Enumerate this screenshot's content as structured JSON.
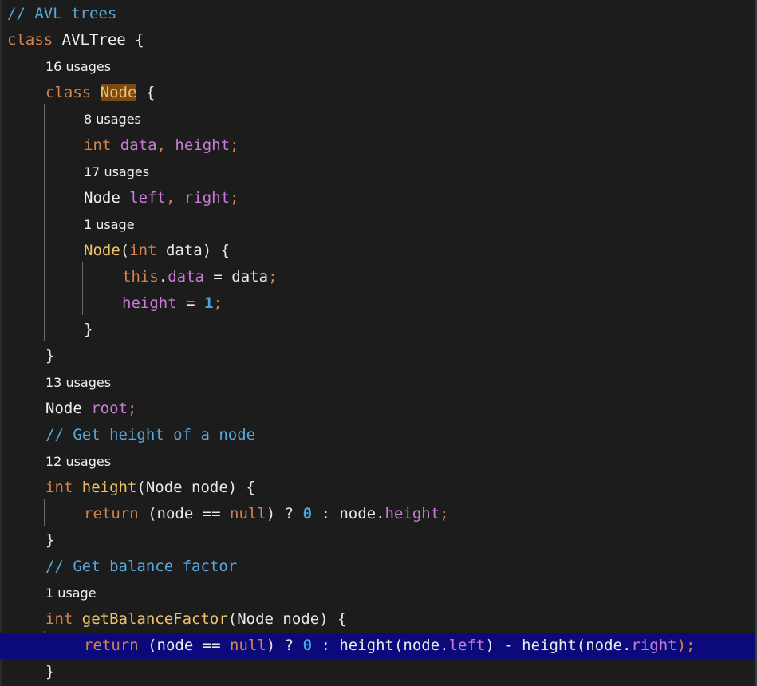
{
  "editor": {
    "language": "java",
    "accent_highlight": "#0c0a7a",
    "selection_color": "#7a4a12"
  },
  "lines": [
    {
      "indent": 0,
      "kind": "code",
      "tokens": [
        {
          "t": "// AVL trees",
          "c": "cmt"
        }
      ]
    },
    {
      "indent": 0,
      "kind": "code",
      "tokens": [
        {
          "t": "class ",
          "c": "kw"
        },
        {
          "t": "AVLTree",
          "c": "cls"
        },
        {
          "t": " {",
          "c": "punc"
        }
      ]
    },
    {
      "indent": 2,
      "kind": "hint",
      "text": "16 usages"
    },
    {
      "indent": 2,
      "kind": "code",
      "tokens": [
        {
          "t": "class ",
          "c": "kw"
        },
        {
          "t": "Node",
          "c": "hl-node"
        },
        {
          "t": " {",
          "c": "punc"
        }
      ]
    },
    {
      "indent": 4,
      "kind": "hint",
      "text": "8 usages"
    },
    {
      "indent": 4,
      "kind": "code",
      "tokens": [
        {
          "t": "int ",
          "c": "kw"
        },
        {
          "t": "data",
          "c": "field"
        },
        {
          "t": ", ",
          "c": "sc"
        },
        {
          "t": "height",
          "c": "field"
        },
        {
          "t": ";",
          "c": "sc"
        }
      ]
    },
    {
      "indent": 4,
      "kind": "hint",
      "text": "17 usages"
    },
    {
      "indent": 4,
      "kind": "code",
      "tokens": [
        {
          "t": "Node ",
          "c": "cls"
        },
        {
          "t": "left",
          "c": "field"
        },
        {
          "t": ", ",
          "c": "sc"
        },
        {
          "t": "right",
          "c": "field"
        },
        {
          "t": ";",
          "c": "sc"
        }
      ]
    },
    {
      "indent": 4,
      "kind": "hint",
      "text": "1 usage"
    },
    {
      "indent": 4,
      "kind": "code",
      "tokens": [
        {
          "t": "Node",
          "c": "fn"
        },
        {
          "t": "(",
          "c": "punc"
        },
        {
          "t": "int ",
          "c": "kw"
        },
        {
          "t": "data) {",
          "c": "punc"
        }
      ]
    },
    {
      "indent": 6,
      "kind": "code",
      "tokens": [
        {
          "t": "this",
          "c": "kw"
        },
        {
          "t": ".",
          "c": "punc"
        },
        {
          "t": "data",
          "c": "field"
        },
        {
          "t": " = data",
          "c": "punc"
        },
        {
          "t": ";",
          "c": "sc"
        }
      ]
    },
    {
      "indent": 6,
      "kind": "code",
      "tokens": [
        {
          "t": "height",
          "c": "field"
        },
        {
          "t": " = ",
          "c": "punc"
        },
        {
          "t": "1",
          "c": "num"
        },
        {
          "t": ";",
          "c": "sc"
        }
      ]
    },
    {
      "indent": 4,
      "kind": "code",
      "tokens": [
        {
          "t": "}",
          "c": "punc"
        }
      ]
    },
    {
      "indent": 2,
      "kind": "code",
      "tokens": [
        {
          "t": "}",
          "c": "punc"
        }
      ]
    },
    {
      "indent": 2,
      "kind": "hint",
      "text": "13 usages"
    },
    {
      "indent": 2,
      "kind": "code",
      "tokens": [
        {
          "t": "Node ",
          "c": "cls"
        },
        {
          "t": "root",
          "c": "field"
        },
        {
          "t": ";",
          "c": "sc"
        }
      ]
    },
    {
      "indent": 2,
      "kind": "code",
      "tokens": [
        {
          "t": "// Get height of a node",
          "c": "cmt"
        }
      ]
    },
    {
      "indent": 2,
      "kind": "hint",
      "text": "12 usages"
    },
    {
      "indent": 2,
      "kind": "code",
      "tokens": [
        {
          "t": "int ",
          "c": "kw"
        },
        {
          "t": "height",
          "c": "fn"
        },
        {
          "t": "(Node node) {",
          "c": "punc"
        }
      ]
    },
    {
      "indent": 4,
      "kind": "code",
      "tokens": [
        {
          "t": "return ",
          "c": "kw"
        },
        {
          "t": "(node == ",
          "c": "punc"
        },
        {
          "t": "null",
          "c": "kw"
        },
        {
          "t": ") ? ",
          "c": "punc"
        },
        {
          "t": "0",
          "c": "num"
        },
        {
          "t": " : node.",
          "c": "punc"
        },
        {
          "t": "height",
          "c": "field"
        },
        {
          "t": ";",
          "c": "sc"
        }
      ]
    },
    {
      "indent": 2,
      "kind": "code",
      "tokens": [
        {
          "t": "}",
          "c": "punc"
        }
      ]
    },
    {
      "indent": 2,
      "kind": "code",
      "tokens": [
        {
          "t": "// Get balance factor",
          "c": "cmt"
        }
      ]
    },
    {
      "indent": 2,
      "kind": "hint",
      "text": "1 usage"
    },
    {
      "indent": 2,
      "kind": "code",
      "tokens": [
        {
          "t": "int ",
          "c": "kw"
        },
        {
          "t": "getBalanceFactor",
          "c": "fn"
        },
        {
          "t": "(Node node) {",
          "c": "punc"
        }
      ]
    },
    {
      "indent": 4,
      "kind": "code",
      "highlighted": true,
      "tokens": [
        {
          "t": "return ",
          "c": "kw"
        },
        {
          "t": "(node == ",
          "c": "punc"
        },
        {
          "t": "null",
          "c": "kw"
        },
        {
          "t": ") ? ",
          "c": "punc"
        },
        {
          "t": "0",
          "c": "num"
        },
        {
          "t": " : height(node.",
          "c": "punc"
        },
        {
          "t": "left",
          "c": "field"
        },
        {
          "t": ") - height(node.",
          "c": "punc"
        },
        {
          "t": "right",
          "c": "field"
        },
        {
          "t": ");",
          "c": "sc"
        }
      ]
    },
    {
      "indent": 2,
      "kind": "code",
      "tokens": [
        {
          "t": "}",
          "c": "punc"
        }
      ]
    }
  ]
}
